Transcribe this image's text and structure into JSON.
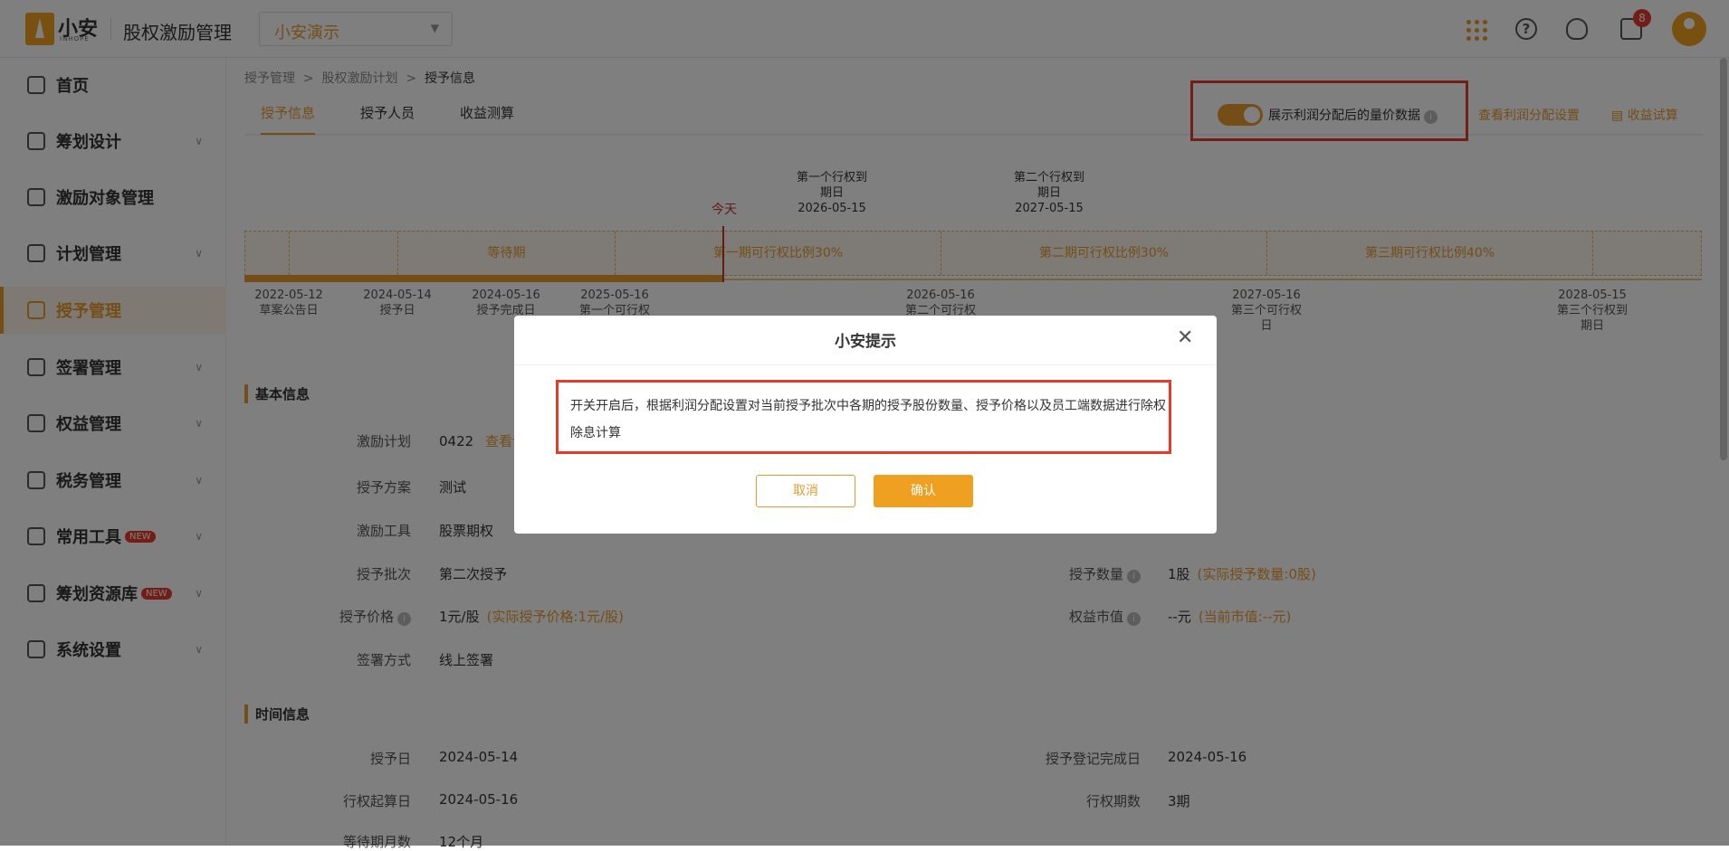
{
  "header": {
    "brand": "小安",
    "brand_sub": "INHOPE",
    "app_title": "股权激励管理",
    "company_selector": "小安演示",
    "notification_count": "8"
  },
  "sidebar": {
    "items": [
      {
        "label": "首页"
      },
      {
        "label": "筹划设计"
      },
      {
        "label": "激励对象管理"
      },
      {
        "label": "计划管理"
      },
      {
        "label": "授予管理"
      },
      {
        "label": "签署管理"
      },
      {
        "label": "权益管理"
      },
      {
        "label": "税务管理"
      },
      {
        "label": "常用工具",
        "badge": "NEW"
      },
      {
        "label": "筹划资源库",
        "badge": "NEW"
      },
      {
        "label": "系统设置"
      }
    ],
    "active": "授予管理"
  },
  "breadcrumb": [
    "授予管理",
    "股权激励计划",
    "授予信息"
  ],
  "tabs": [
    "授予信息",
    "授予人员",
    "收益测算"
  ],
  "toolbar": {
    "toggle_label": "展示利润分配后的量价数据",
    "toggle_on": true,
    "view_profit_link": "查看利润分配设置",
    "calc_link": "收益试算"
  },
  "timeline": {
    "today_label": "今天",
    "top_events": [
      {
        "title": "第一个行权到",
        "title2": "期日",
        "date": "2026-05-15"
      },
      {
        "title": "第二个行权到",
        "title2": "期日",
        "date": "2027-05-15"
      }
    ],
    "segments": [
      "等待期",
      "第一期可行权比例30%",
      "第二期可行权比例30%",
      "第三期可行权比例40%"
    ],
    "bottom_events": [
      {
        "date": "2022-05-12",
        "label": "草案公告日"
      },
      {
        "date": "2024-05-14",
        "label": "授予日"
      },
      {
        "date": "2024-05-16",
        "label": "授予完成日"
      },
      {
        "date": "2025-05-16",
        "label": "第一个可行权"
      },
      {
        "date": "2026-05-16",
        "label": "第二个可行权"
      },
      {
        "date": "2027-05-16",
        "label": "第三个可行权",
        "label2": "日"
      },
      {
        "date": "2028-05-15",
        "label": "第三个行权到",
        "label2": "期日"
      }
    ]
  },
  "basic_info": {
    "title": "基本信息",
    "plan_label": "激励计划",
    "plan_value": "0422",
    "plan_link": "查看详",
    "scheme_label": "授予方案",
    "scheme_value": "测试",
    "tool_label": "激励工具",
    "tool_value": "股票期权",
    "batch_label": "授予批次",
    "batch_value": "第二次授予",
    "price_label": "授予价格",
    "price_value": "1元/股",
    "price_actual": "(实际授予价格:1元/股)",
    "sign_label": "签署方式",
    "sign_value": "线上签署",
    "qty_label": "授予数量",
    "qty_value": "1股",
    "qty_actual": "(实际授予数量:0股)",
    "mkt_label": "权益市值",
    "mkt_value": "--元",
    "mkt_current": "(当前市值:--元)"
  },
  "time_info": {
    "title": "时间信息",
    "grant_date_label": "授予日",
    "grant_date_value": "2024-05-14",
    "reg_date_label": "授予登记完成日",
    "reg_date_value": "2024-05-16",
    "start_label": "行权起算日",
    "start_value": "2024-05-16",
    "periods_label": "行权期数",
    "periods_value": "3期",
    "wait_label": "等待期月数",
    "wait_value": "12个月"
  },
  "modal": {
    "title": "小安提示",
    "body": "开关开启后，根据利润分配设置对当前授予批次中各期的授予股份数量、授予价格以及员工端数据进行除权除息计算",
    "cancel": "取消",
    "confirm": "确认"
  }
}
